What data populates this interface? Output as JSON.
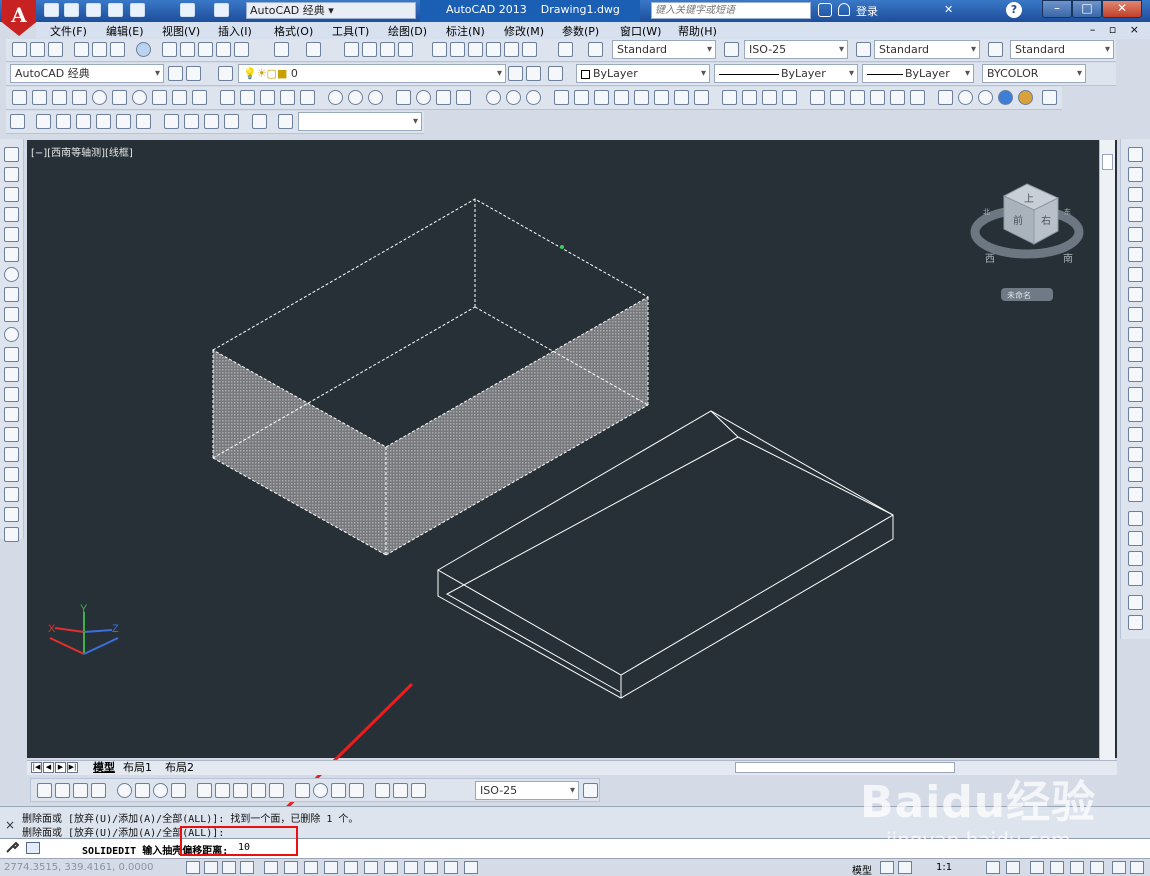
{
  "app": {
    "logo_letter": "A",
    "workspace": "AutoCAD 经典",
    "title_app": "AutoCAD 2013",
    "title_file": "Drawing1.dwg",
    "search_placeholder": "键入关键字或短语",
    "login_label": "登录",
    "window_buttons": [
      "–",
      "□",
      "✕"
    ],
    "doc_controls": "– ▫ ×"
  },
  "menu": {
    "items": [
      "文件(F)",
      "编辑(E)",
      "视图(V)",
      "插入(I)",
      "格式(O)",
      "工具(T)",
      "绘图(D)",
      "标注(N)",
      "修改(M)",
      "参数(P)",
      "窗口(W)",
      "帮助(H)"
    ]
  },
  "toolbar_styles": {
    "text_style": "Standard",
    "dim_style": "ISO-25",
    "table_style": "Standard",
    "multileader_style": "Standard",
    "workspace_combo": "AutoCAD 经典",
    "layer_value": "0",
    "color": "ByLayer",
    "linetype": "ByLayer",
    "lineweight": "ByLayer",
    "plotstyle": "BYCOLOR"
  },
  "viewport": {
    "label": "[−][西南等轴测][线框]",
    "background": "#263036",
    "wire_color": "#ffffff",
    "shade_color": "#8d8f92",
    "axis_colors": {
      "x": "#e03030",
      "y": "#3bb34a",
      "z": "#3a6fe0"
    },
    "ucs_labels": {
      "x": "X",
      "y": "Y",
      "z": "Z"
    },
    "viewcube_faces": {
      "top": "上",
      "front": "前",
      "right": "右"
    },
    "compass": {
      "left": "西",
      "right": "南",
      "top_left": "北",
      "top_right": "东"
    },
    "ucs_menu": "未命名"
  },
  "layout_tabs": {
    "tabs": [
      "模型",
      "布局1",
      "布局2"
    ],
    "nav": [
      "|◀",
      "◀",
      "▶",
      "▶|"
    ]
  },
  "dim_toolbar": {
    "dim_style": "ISO-25"
  },
  "command": {
    "history": [
      "删除面或 [放弃(U)/添加(A)/全部(ALL)]: 找到一个面，已删除 1 个。",
      "删除面或 [放弃(U)/添加(A)/全部(ALL)]:"
    ],
    "prompt": "SOLIDEDIT 输入抽壳偏移距离:",
    "value": "10",
    "close_label": "×"
  },
  "statusbar": {
    "coords": "2774.3515, 339.4161, 0.0000",
    "model_label": "模型",
    "scale_label": "1:1"
  },
  "watermark": {
    "brand": "Baidu经验",
    "url": "jingyan.baidu.com"
  }
}
